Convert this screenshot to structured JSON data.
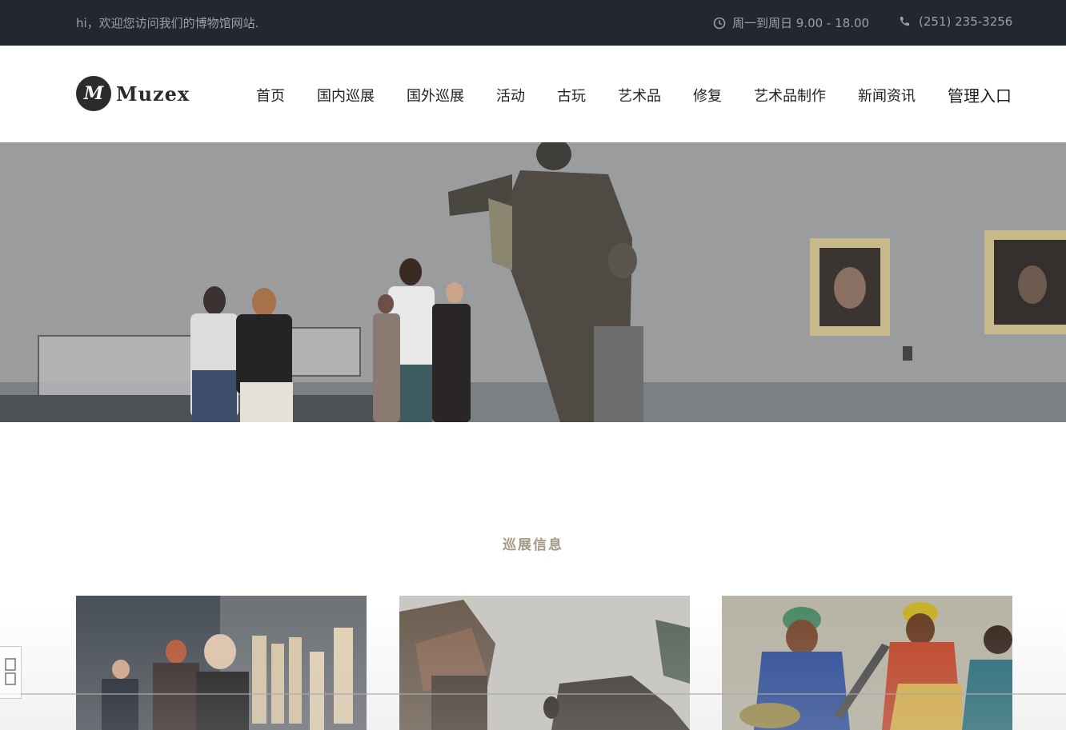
{
  "topbar": {
    "greeting": "hi，欢迎您访问我们的博物馆网站.",
    "hours": "周一到周日 9.00 - 18.00",
    "phone": "(251) 235-3256"
  },
  "logo": {
    "mark": "M",
    "text": "Muzex"
  },
  "nav": {
    "items": [
      "首页",
      "国内巡展",
      "国外巡展",
      "活动",
      "古玩",
      "艺术品",
      "修复",
      "艺术品制作",
      "新闻资讯",
      "管理入口"
    ]
  },
  "section": {
    "title": "巡展信息"
  },
  "colors": {
    "topbar_bg": "#23272e",
    "accent": "#a39a86"
  }
}
